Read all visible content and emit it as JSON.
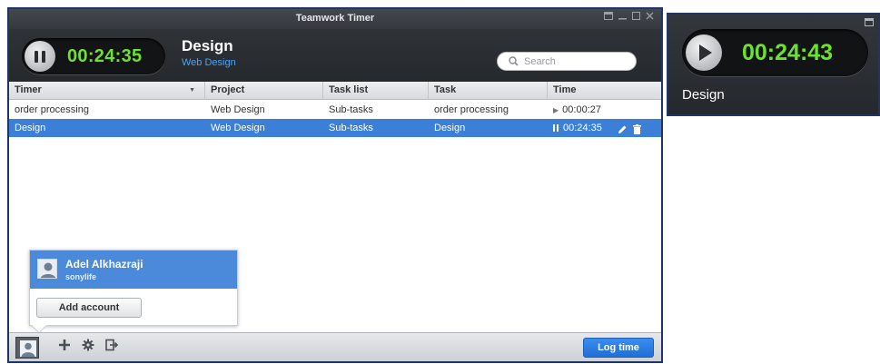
{
  "window": {
    "title": "Teamwork Timer"
  },
  "header": {
    "timer_value": "00:24:35",
    "current_task": "Design",
    "current_project": "Web Design",
    "search_placeholder": "Search"
  },
  "table": {
    "columns": [
      "Timer",
      "Project",
      "Task list",
      "Task",
      "Time"
    ],
    "rows": [
      {
        "timer": "order processing",
        "project": "Web Design",
        "tasklist": "Sub-tasks",
        "task": "order processing",
        "time": "00:00:27",
        "state": "stopped"
      },
      {
        "timer": "Design",
        "project": "Web Design",
        "tasklist": "Sub-tasks",
        "task": "Design",
        "time": "00:24:35",
        "state": "running"
      }
    ]
  },
  "account_popup": {
    "name": "Adel Alkhazraji",
    "subtitle": "sonylife",
    "add_account_label": "Add account"
  },
  "bottom_bar": {
    "log_time_label": "Log time"
  },
  "mini_window": {
    "timer_value": "00:24:43",
    "task": "Design"
  },
  "colors": {
    "accent": "#3c7fd6",
    "timer_green": "#6de22e",
    "header_dark": "#2f3338",
    "link_blue": "#4fa3f0"
  },
  "icons": [
    "pause-icon",
    "play-icon",
    "search-icon",
    "edit-icon",
    "trash-icon",
    "user-icon",
    "plus-icon",
    "gear-icon",
    "logout-icon",
    "minimize-icon",
    "maximize-icon",
    "close-icon",
    "restore-icon"
  ]
}
